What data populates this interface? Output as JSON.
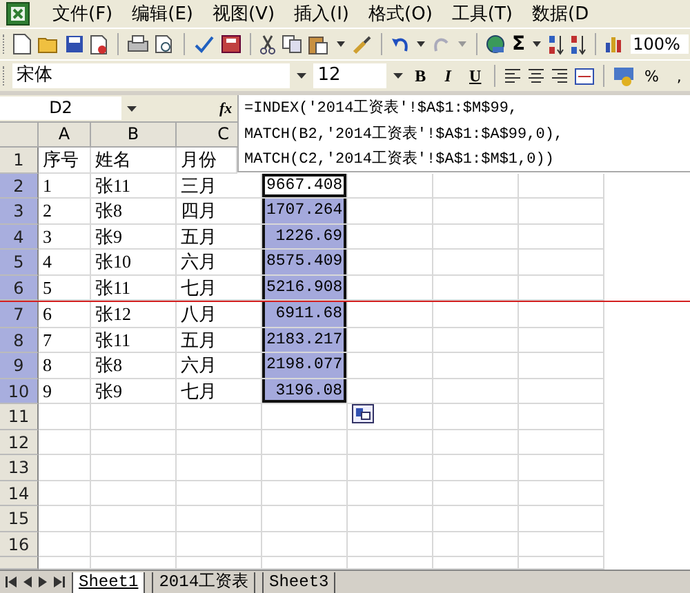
{
  "menu": [
    {
      "label": "文件(F)"
    },
    {
      "label": "编辑(E)"
    },
    {
      "label": "视图(V)"
    },
    {
      "label": "插入(I)"
    },
    {
      "label": "格式(O)"
    },
    {
      "label": "工具(T)"
    },
    {
      "label": "数据(D"
    }
  ],
  "toolbar": {
    "sum_symbol": "Σ",
    "zoom": "100%"
  },
  "format_bar": {
    "font": "宋体",
    "size": "12",
    "bold": "B",
    "italic": "I",
    "underline": "U",
    "percent": "%",
    "comma": ","
  },
  "formula_bar": {
    "name_box": "D2",
    "fx": "fx",
    "formula": [
      "=INDEX('2014工资表'!$A$1:$M$99,",
      "MATCH(B2,'2014工资表'!$A$1:$A$99,0),",
      "MATCH(C2,'2014工资表'!$A$1:$M$1,0))"
    ]
  },
  "columns": [
    "A",
    "B",
    "C"
  ],
  "rows": [
    {
      "num": "1",
      "cells": [
        "序号",
        "姓名",
        "月份"
      ],
      "selected": false
    },
    {
      "num": "2",
      "cells": [
        "1",
        "张11",
        "三月",
        "9667.408"
      ],
      "selected": true,
      "active": true
    },
    {
      "num": "3",
      "cells": [
        "2",
        "张8",
        "四月",
        "1707.264"
      ],
      "selected": true,
      "active": false
    },
    {
      "num": "4",
      "cells": [
        "3",
        "张9",
        "五月",
        "1226.69"
      ],
      "selected": true,
      "active": false
    },
    {
      "num": "5",
      "cells": [
        "4",
        "张10",
        "六月",
        "8575.409"
      ],
      "selected": true,
      "active": false
    },
    {
      "num": "6",
      "cells": [
        "5",
        "张11",
        "七月",
        "5216.908"
      ],
      "selected": true,
      "active": false
    },
    {
      "num": "7",
      "cells": [
        "6",
        "张12",
        "八月",
        "6911.68"
      ],
      "selected": true,
      "active": false
    },
    {
      "num": "8",
      "cells": [
        "7",
        "张11",
        "五月",
        "2183.217"
      ],
      "selected": true,
      "active": false
    },
    {
      "num": "9",
      "cells": [
        "8",
        "张8",
        "六月",
        "2198.077"
      ],
      "selected": true,
      "active": false
    },
    {
      "num": "10",
      "cells": [
        "9",
        "张9",
        "七月",
        "3196.08"
      ],
      "selected": true,
      "active": false
    },
    {
      "num": "11",
      "selected": false,
      "active": false
    },
    {
      "num": "12",
      "selected": false,
      "active": false
    },
    {
      "num": "13",
      "selected": false,
      "active": false
    },
    {
      "num": "14",
      "selected": false,
      "active": false
    },
    {
      "num": "15",
      "selected": false,
      "active": false
    },
    {
      "num": "16",
      "selected": false,
      "active": false
    }
  ],
  "sheet_tabs": [
    {
      "label": "Sheet1",
      "selected": true
    },
    {
      "label": "2014工资表",
      "selected": false
    },
    {
      "label": "Sheet3",
      "selected": false
    }
  ]
}
